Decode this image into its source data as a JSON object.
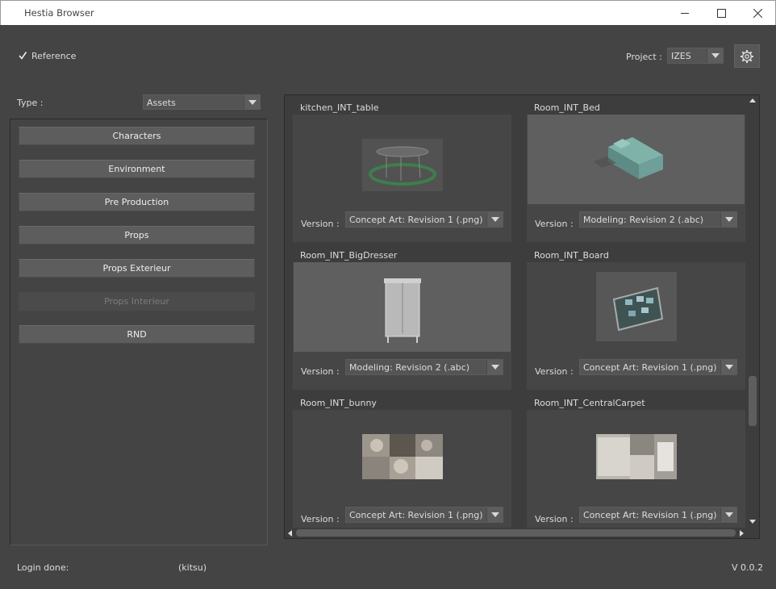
{
  "window": {
    "title": "Hestia Browser",
    "controls": [
      "minimize",
      "maximize",
      "close"
    ]
  },
  "reference": {
    "label": "Reference",
    "checked": true
  },
  "project": {
    "label": "Project :",
    "value": "IZES",
    "settings_icon": "gear-icon"
  },
  "type": {
    "label": "Type :",
    "value": "Assets"
  },
  "categories": [
    {
      "label": "Characters",
      "enabled": true
    },
    {
      "label": "Environment",
      "enabled": true
    },
    {
      "label": "Pre Production",
      "enabled": true
    },
    {
      "label": "Props",
      "enabled": true
    },
    {
      "label": "Props Exterieur",
      "enabled": true
    },
    {
      "label": "Props Interieur",
      "enabled": false
    },
    {
      "label": "RND",
      "enabled": true
    }
  ],
  "assets": [
    {
      "name": "kitchen_INT_table",
      "version_label": "Version :",
      "version": "Concept Art: Revision 1 (.png)"
    },
    {
      "name": "Room_INT_Bed",
      "version_label": "Version :",
      "version": "Modeling: Revision 2 (.abc)"
    },
    {
      "name": "Room_INT_BigDresser",
      "version_label": "Version :",
      "version": "Modeling: Revision 2 (.abc)"
    },
    {
      "name": "Room_INT_Board",
      "version_label": "Version :",
      "version": "Concept Art: Revision 1 (.png)"
    },
    {
      "name": "Room_INT_bunny",
      "version_label": "Version :",
      "version": "Concept Art: Revision 1 (.png)"
    },
    {
      "name": "Room_INT_CentralCarpet",
      "version_label": "Version :",
      "version": "Concept Art: Revision 1 (.png)"
    }
  ],
  "footer": {
    "status": "Login done:",
    "user": "(kitsu)",
    "version": "V 0.0.2"
  },
  "colors": {
    "background": "#444444",
    "panel": "#3d3d3d",
    "button": "#5d5d5d",
    "text": "#dddddd"
  }
}
